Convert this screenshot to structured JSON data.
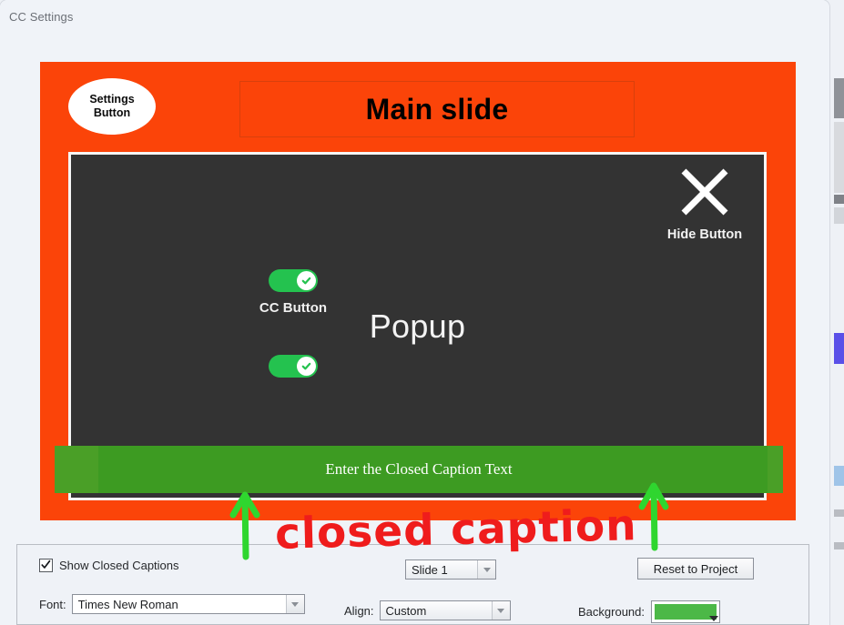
{
  "window": {
    "title": "CC Settings"
  },
  "slide": {
    "settings_button_line1": "Settings",
    "settings_button_line2": "Button",
    "title": "Main slide",
    "popup_label": "Popup",
    "hide_button_label": "Hide Button",
    "cc_button_label": "CC Button",
    "caption_text": "Enter the Closed Caption Text",
    "frame_color": "#fb4409",
    "popup_color": "#333333",
    "caption_bar_color": "#4a9f27"
  },
  "annotation": {
    "text": "closed caption",
    "text_color": "#ef1c1c",
    "arrow_color": "#2fd62f"
  },
  "panel": {
    "show_closed_captions_label": "Show Closed Captions",
    "show_closed_captions_checked": true,
    "font_label": "Font:",
    "font_value": "Times New Roman",
    "slide_value": "Slide 1",
    "align_label": "Align:",
    "align_value": "Custom",
    "reset_label": "Reset to Project",
    "background_label": "Background:",
    "background_color": "#4cb847"
  },
  "icons": {
    "hide": "close-x-icon",
    "checkmark": "check-icon",
    "dropdown": "chevron-down-icon"
  }
}
